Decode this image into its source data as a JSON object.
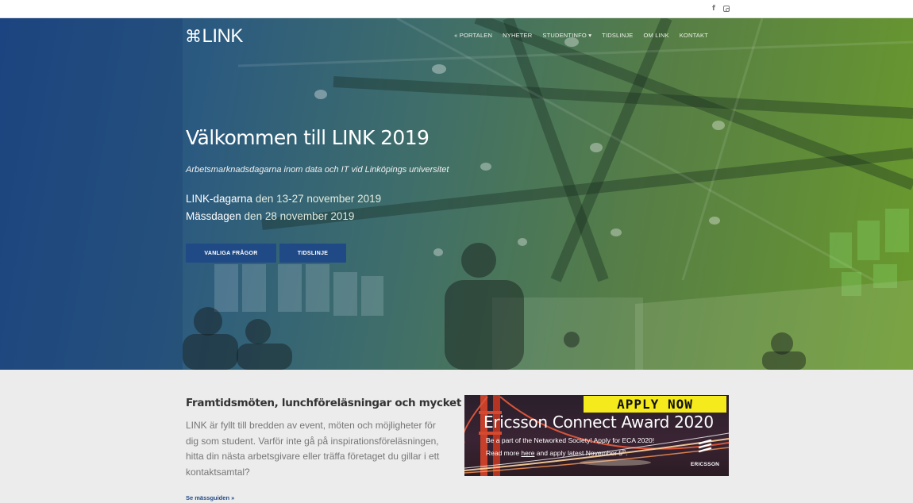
{
  "topbar": {
    "social": [
      {
        "icon": "facebook-icon",
        "glyph": "f"
      },
      {
        "icon": "instagram-icon"
      }
    ]
  },
  "header": {
    "logo_mark": "⌘",
    "logo_text": "LINK",
    "nav": [
      "« PORTALEN",
      "NYHETER",
      "STUDENTINFO ▾",
      "TIDSLINJE",
      "OM LINK",
      "KONTAKT"
    ]
  },
  "hero": {
    "title": "Välkommen till LINK 2019",
    "subtitle": "Arbetsmarknadsdagarna inom data och IT vid Linköpings universitet",
    "date1_label": "LINK-dagarna",
    "date1_value": " den 13-27 november 2019",
    "date2_label": "Mässdagen",
    "date2_value": " den 28 november 2019",
    "button1": "VANLIGA FRÅGOR",
    "button2": "TIDSLINJE"
  },
  "content": {
    "title": "Framtidsmöten, lunchföreläsningar och mycket mer",
    "text": "LINK är fyllt till bredden av event, möten och möjligheter för dig som student. Varför inte gå på inspirationsföreläsningen, hitta din nästa arbetsgivare eller träffa företaget du gillar i ett kontaktsamtal?",
    "link": "Se mässguiden »"
  },
  "banner": {
    "apply": "APPLY NOW",
    "title": "Ericsson Connect Award 2020",
    "line1": "Be a part of the Networked Society! Apply for ECA 2020!",
    "line2_pre": "Read more ",
    "line2_link": "here",
    "line2_mid": " and apply latest November 5",
    "line2_sup": "th",
    "line2_end": ".",
    "brand": "ERICSSON"
  },
  "colors": {
    "accent": "#1f4a86",
    "hero_left": "#1f4a86",
    "hero_right": "#6a9a2c",
    "banner_yellow": "#f4ea1c"
  }
}
